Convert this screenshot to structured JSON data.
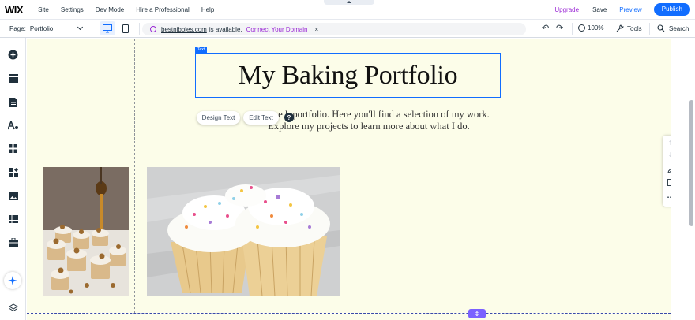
{
  "topbar": {
    "logo": "WIX",
    "menu": [
      "Site",
      "Settings",
      "Dev Mode",
      "Hire a Professional",
      "Help"
    ],
    "upgrade": "Upgrade",
    "save": "Save",
    "preview": "Preview",
    "publish": "Publish"
  },
  "pagebar": {
    "page_label": "Page:",
    "page_value": "Portfolio",
    "domain_name": "bestnibbles.com",
    "domain_text": "is available.",
    "connect_link": "Connect Your Domain",
    "close": "×",
    "zoom": "100%",
    "tools": "Tools",
    "search": "Search"
  },
  "canvas": {
    "text_tag": "Text",
    "title": "My Baking Portfolio",
    "paragraph_line1": "e  k  portfolio. Here you'll find a selection of my work.",
    "paragraph_line2": "Explore my projects to learn more about what I do.",
    "design_text": "Design Text",
    "edit_text": "Edit Text",
    "help": "?",
    "resize_icon": "↕"
  },
  "colors": {
    "accent": "#116dff",
    "upgrade": "#9a27d5",
    "canvas_bg": "#fcfde9",
    "handle": "#7b61ff"
  }
}
